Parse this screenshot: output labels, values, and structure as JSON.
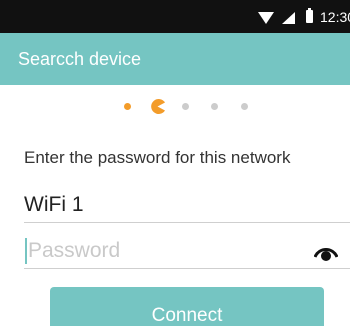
{
  "status_bar": {
    "time": "12:30",
    "icons": [
      "wifi-icon",
      "signal-icon",
      "battery-icon"
    ]
  },
  "app_bar": {
    "title": "Searcch device"
  },
  "pager": {
    "total_steps": 5,
    "current_step": 2,
    "active_color": "#f39c2a",
    "inactive_color": "#cccccc"
  },
  "form": {
    "prompt": "Enter the password for this network",
    "network_name": "WiFi 1",
    "password_value": "",
    "password_placeholder": "Password",
    "visibility_icon": "eye-icon",
    "connect_label": "Connect"
  },
  "colors": {
    "accent": "#75c5c2",
    "status_bar": "#111111"
  }
}
